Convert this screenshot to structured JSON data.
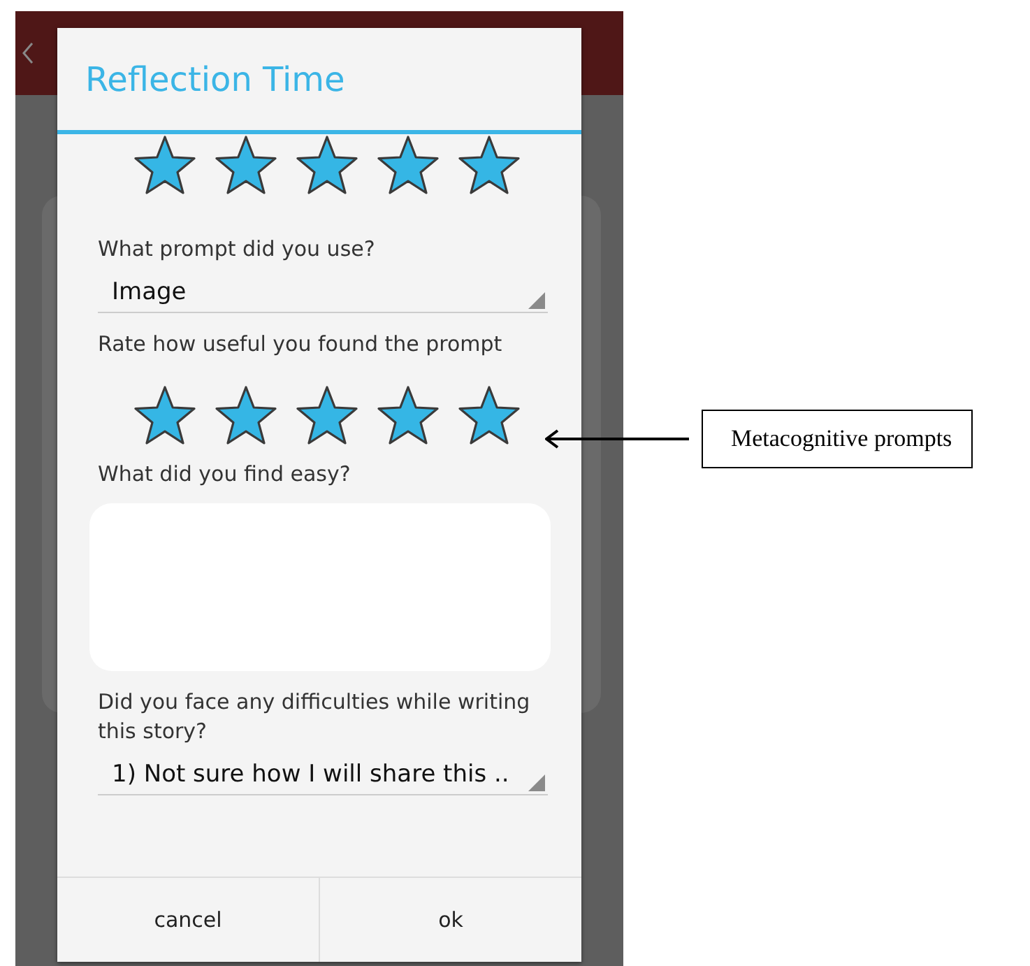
{
  "dialog": {
    "title": "Reflection Time",
    "sections": [
      {
        "kind": "stars",
        "stars": 5
      },
      {
        "kind": "label",
        "text": "What prompt did you use?"
      },
      {
        "kind": "dropdown",
        "value": "Image"
      },
      {
        "kind": "label",
        "text": "Rate how useful you found the prompt"
      },
      {
        "kind": "stars",
        "stars": 5
      },
      {
        "kind": "label",
        "text": "What did you find easy?"
      },
      {
        "kind": "textarea"
      },
      {
        "kind": "label",
        "text": "Did you face any difficulties while writing this story?"
      },
      {
        "kind": "dropdown",
        "value": "1) Not sure how I will share this .."
      }
    ],
    "buttons": [
      "cancel",
      "ok"
    ]
  },
  "annotation": {
    "text": "Metacognitive prompts"
  }
}
